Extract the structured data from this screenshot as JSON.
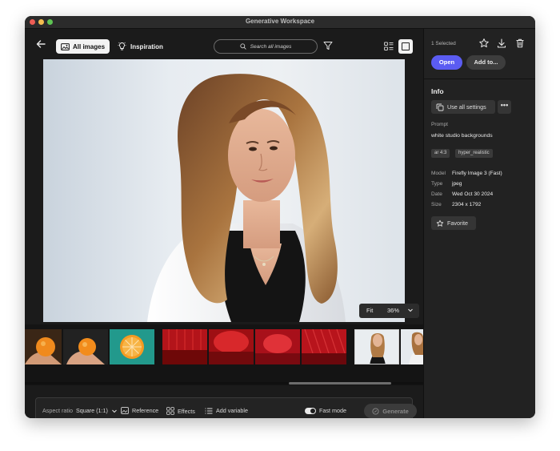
{
  "window": {
    "title": "Generative Workspace"
  },
  "toolbar": {
    "all_images": "All images",
    "inspiration": "Inspiration",
    "search_placeholder": "Search all images"
  },
  "viewer": {
    "zoom_mode": "Fit",
    "zoom_level": "36%"
  },
  "filmstrip": {
    "thumbnails": [
      "orange-in-hand",
      "orange-in-hand",
      "orange-slice-teal",
      "red-stage",
      "red-stage",
      "red-stage",
      "red-curtain",
      "woman-portrait",
      "woman-portrait"
    ]
  },
  "prompt_bar": {
    "aspect_label": "Aspect ratio",
    "aspect_value": "Square (1:1)",
    "reference": "Reference",
    "effects": "Effects",
    "add_variable": "Add variable",
    "fast_mode": "Fast mode",
    "generate": "Generate"
  },
  "panel": {
    "selected": "1 Selected",
    "open": "Open",
    "add_to": "Add to...",
    "info_title": "Info",
    "use_all_settings": "Use all settings",
    "more": "•••",
    "prompt_label": "Prompt",
    "prompt_text": "white studio backgrounds",
    "tags": [
      "ar 4:3",
      "hyper_realistic"
    ],
    "meta": [
      {
        "key": "Model",
        "value": "Firefly Image 3 (Fast)"
      },
      {
        "key": "Type",
        "value": "jpeg"
      },
      {
        "key": "Date",
        "value": "Wed Oct 30 2024"
      },
      {
        "key": "Size",
        "value": "2304 x 1792"
      }
    ],
    "favorite": "Favorite"
  },
  "colors": {
    "accent": "#5b5cf2",
    "background": "#1b1b1b",
    "panel": "#222222"
  }
}
